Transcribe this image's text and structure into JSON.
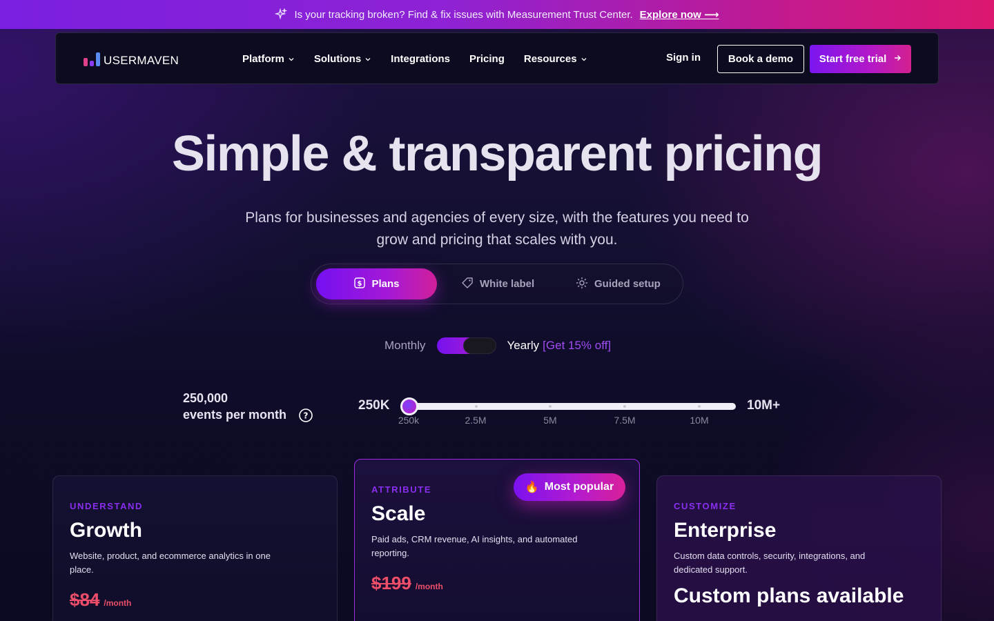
{
  "announcement": {
    "text": "Is your tracking broken? Find & fix issues with Measurement Trust Center.",
    "cta": "Explore now ⟶",
    "icon": "sparkle-icon"
  },
  "nav": {
    "logo_text": "USERMAVEN",
    "menu": [
      {
        "label": "Platform",
        "has_dropdown": true
      },
      {
        "label": "Solutions",
        "has_dropdown": true
      },
      {
        "label": "Integrations",
        "has_dropdown": false
      },
      {
        "label": "Pricing",
        "has_dropdown": false
      },
      {
        "label": "Resources",
        "has_dropdown": true
      }
    ],
    "sign_in": "Sign in",
    "book_demo": "Book a demo",
    "start_trial": "Start free trial"
  },
  "hero": {
    "title": "Simple & transparent pricing",
    "subtitle": "Plans for businesses and agencies of every size, with the features you need to grow and pricing that scales with you."
  },
  "tabs": [
    {
      "label": "Plans",
      "icon": "dollar-icon",
      "active": true
    },
    {
      "label": "White label",
      "icon": "tag-icon",
      "active": false
    },
    {
      "label": "Guided setup",
      "icon": "gear-icon",
      "active": false
    }
  ],
  "billing": {
    "monthly": "Monthly",
    "yearly": "Yearly",
    "discount": "[Get 15% off]",
    "selected": "yearly"
  },
  "events": {
    "value": "250,000",
    "unit": "events per month",
    "slider_min": "250K",
    "slider_max": "10M+",
    "slider_position": 0,
    "ticks": [
      "250k",
      "2.5M",
      "5M",
      "7.5M",
      "10M"
    ]
  },
  "plans": [
    {
      "eyebrow": "UNDERSTAND",
      "name": "Growth",
      "description": "Website, product, and ecommerce analytics in one place.",
      "old_price": "$84",
      "per": "/month"
    },
    {
      "eyebrow": "ATTRIBUTE",
      "name": "Scale",
      "badge": "Most popular",
      "badge_icon": "fire-icon",
      "description": "Paid ads, CRM revenue, AI insights, and automated reporting.",
      "old_price": "$199",
      "per": "/month"
    },
    {
      "eyebrow": "CUSTOMIZE",
      "name": "Enterprise",
      "description": "Custom data controls, security, integrations, and dedicated support.",
      "headline": "Custom plans available"
    }
  ],
  "colors": {
    "accent_purple": "#7b16f0",
    "accent_pink": "#d4208f",
    "strike_red": "#ee4e6a",
    "eyebrow_purple": "#8a2ef0"
  }
}
